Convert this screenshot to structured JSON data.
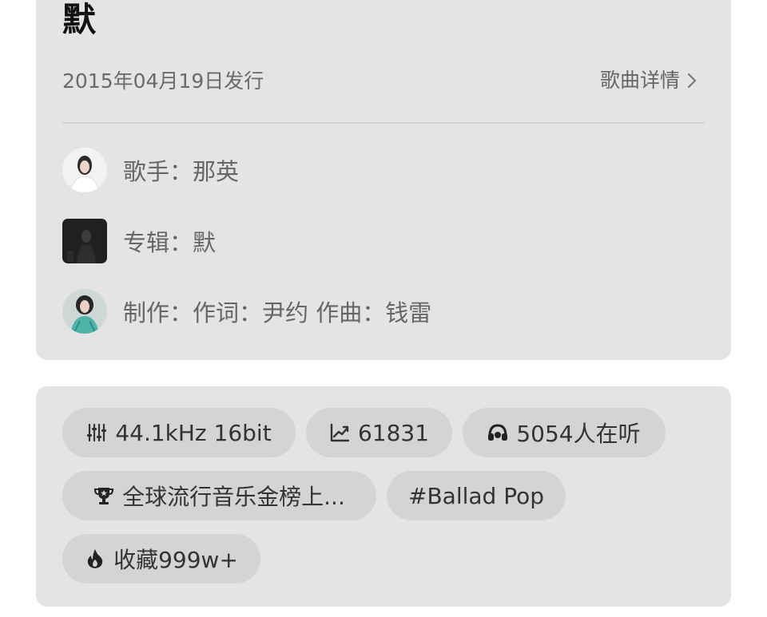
{
  "song": {
    "title": "默",
    "release_date": "2015年04月19日发行",
    "detail_label": "歌曲详情"
  },
  "credits": {
    "singer": "歌手：那英",
    "album": "专辑：默",
    "production": "制作：作词：尹约  作曲：钱雷"
  },
  "tags": {
    "quality": "44.1kHz  16bit",
    "trend": "61831",
    "listeners": "5054人在听",
    "ranking": "全球流行音乐金榜上...",
    "genre": "#Ballad Pop",
    "favorites": "收藏999w+"
  },
  "icons": {
    "detail": "chevron-right-icon",
    "quality": "equalizer-icon",
    "trend": "trend-up-icon",
    "listeners": "headphones-icon",
    "ranking": "trophy-icon",
    "favorites": "flame-icon"
  },
  "colors": {
    "card_bg": "#e4e4e4",
    "chip_bg": "#d4d4d4",
    "title": "#111111",
    "secondary_text": "#666666"
  }
}
